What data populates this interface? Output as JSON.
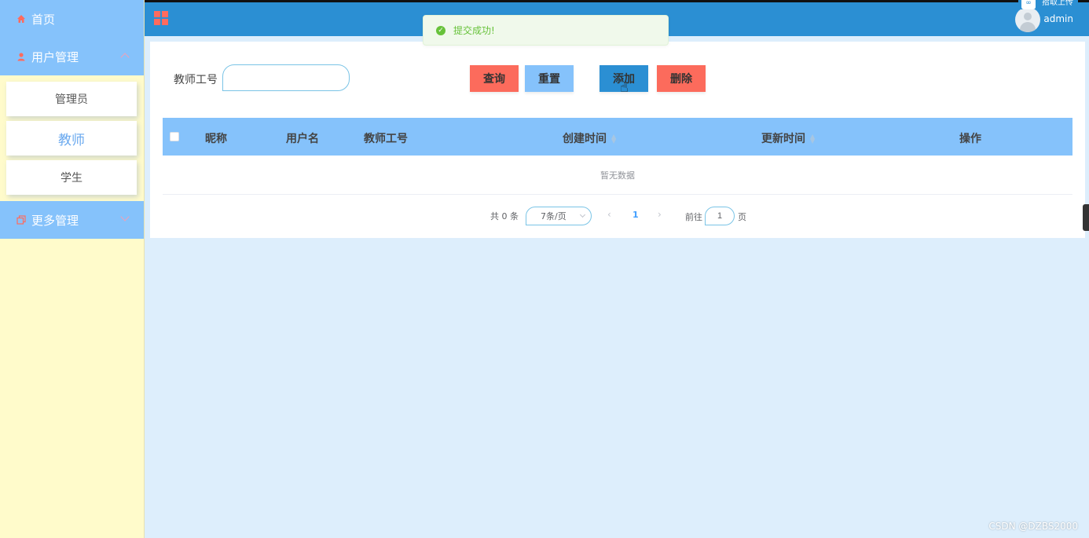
{
  "sidebar": {
    "home_label": "首页",
    "user_mgmt_label": "用户管理",
    "sub_items": [
      "管理员",
      "教师",
      "学生"
    ],
    "more_mgmt_label": "更多管理"
  },
  "header": {
    "username": "admin",
    "corner_badge": "拾取上传"
  },
  "toast": {
    "message": "提交成功!"
  },
  "search": {
    "label": "教师工号",
    "value": ""
  },
  "buttons": {
    "query": "查询",
    "reset": "重置",
    "add": "添加",
    "delete": "删除"
  },
  "table": {
    "columns": [
      "昵称",
      "用户名",
      "教师工号",
      "创建时间",
      "更新时间",
      "操作"
    ],
    "empty_text": "暂无数据"
  },
  "pagination": {
    "total_text": "共 0 条",
    "page_size": "7条/页",
    "current_page": "1",
    "goto_label": "前往",
    "goto_value": "1",
    "page_suffix": "页"
  },
  "watermark": "CSDN @DZBS2000",
  "colors": {
    "header_blue": "#2b8fd3",
    "light_blue": "#85c2fb",
    "coral": "#fc6b5c",
    "sidebar_bg": "#fffbcb",
    "content_bg": "#ddeefc"
  }
}
